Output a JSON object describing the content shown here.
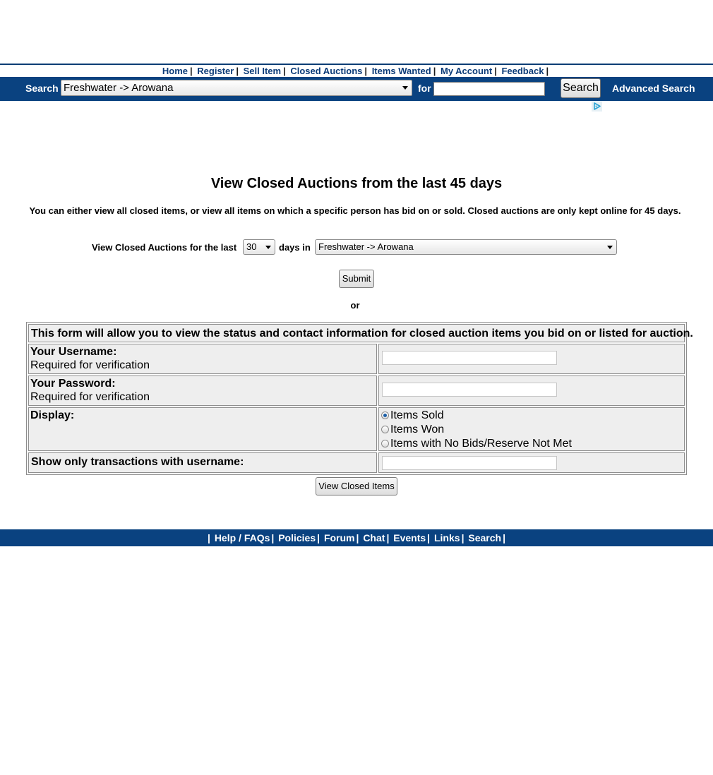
{
  "topnav": {
    "items": [
      "Home",
      "Register",
      "Sell Item",
      "Closed Auctions",
      "Items Wanted",
      "My Account",
      "Feedback"
    ]
  },
  "searchbar": {
    "search_label": "Search",
    "category_value": "Freshwater -> Arowana",
    "for_label": "for",
    "query_value": "",
    "button_label": "Search",
    "advanced_label": "Advanced Search"
  },
  "main": {
    "title": "View Closed Auctions from the last 45 days",
    "intro": "You can either view all closed items, or view all items on which a specific person has bid on or sold. Closed auctions are only kept online for 45 days.",
    "filter": {
      "prefix": "View Closed Auctions for the last",
      "days_value": "30",
      "days_in": "days in",
      "category_value": "Freshwater -> Arowana"
    },
    "submit_label": "Submit",
    "or_text": "or"
  },
  "form": {
    "header": "This form will allow you to view the status and contact information for closed auction items you bid on or listed for auction.",
    "username_label": "Your Username:",
    "username_hint": "Required for verification",
    "username_value": "",
    "password_label": "Your Password:",
    "password_hint": "Required for verification",
    "password_value": "",
    "display_label": "Display:",
    "display_options": [
      "Items Sold",
      "Items Won",
      "Items with No Bids/Reserve Not Met"
    ],
    "display_selected": "Items Sold",
    "filter_user_label": "Show only transactions with username:",
    "filter_user_value": "",
    "submit_label": "View Closed Items"
  },
  "footer": {
    "items": [
      "Help / FAQs",
      "Policies",
      "Forum",
      "Chat",
      "Events",
      "Links",
      "Search"
    ]
  },
  "colors": {
    "nav_blue": "#0a4280",
    "link_blue": "#0b3b78",
    "cell_gray": "#eeeeee"
  },
  "icons": {
    "adchoices": "adchoices-icon",
    "select_caret": "chevron-down-icon",
    "radio": "radio-icon"
  }
}
